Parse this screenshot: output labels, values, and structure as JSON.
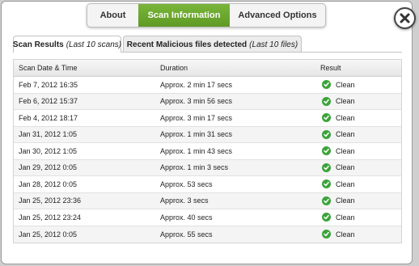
{
  "top_tabs": [
    {
      "label": "About",
      "active": false
    },
    {
      "label": "Scan Information",
      "active": true
    },
    {
      "label": "Advanced Options",
      "active": false
    }
  ],
  "close_icon": "close-icon",
  "sub_tabs": {
    "scan_results": {
      "label": "Scan Results",
      "hint": "(Last 10 scans)"
    },
    "malicious": {
      "label": "Recent Malicious files detected",
      "hint": "(Last 10 files)"
    }
  },
  "table": {
    "headers": [
      "Scan Date & Time",
      "Duration",
      "Result"
    ],
    "rows": [
      {
        "date": "Feb 7, 2012 16:35",
        "duration": "Approx. 2 min 17 secs",
        "result": "Clean"
      },
      {
        "date": "Feb 6, 2012 15:37",
        "duration": "Approx. 3 min 56 secs",
        "result": "Clean"
      },
      {
        "date": "Feb 4, 2012 18:17",
        "duration": "Approx. 3 min 17 secs",
        "result": "Clean"
      },
      {
        "date": "Jan 31, 2012 1:05",
        "duration": "Approx. 1 min 31 secs",
        "result": "Clean"
      },
      {
        "date": "Jan 30, 2012 1:05",
        "duration": "Approx. 1 min 43 secs",
        "result": "Clean"
      },
      {
        "date": "Jan 29, 2012 0:05",
        "duration": "Approx. 1 min 3 secs",
        "result": "Clean"
      },
      {
        "date": "Jan 28, 2012 0:05",
        "duration": "Approx. 53 secs",
        "result": "Clean"
      },
      {
        "date": "Jan 25, 2012 23:36",
        "duration": "Approx. 3 secs",
        "result": "Clean"
      },
      {
        "date": "Jan 25, 2012 23:24",
        "duration": "Approx. 40 secs",
        "result": "Clean"
      },
      {
        "date": "Jan 25, 2012 0:05",
        "duration": "Approx. 55 secs",
        "result": "Clean"
      }
    ]
  },
  "colors": {
    "accent": "#6aa82e",
    "check": "#3ca33a"
  }
}
